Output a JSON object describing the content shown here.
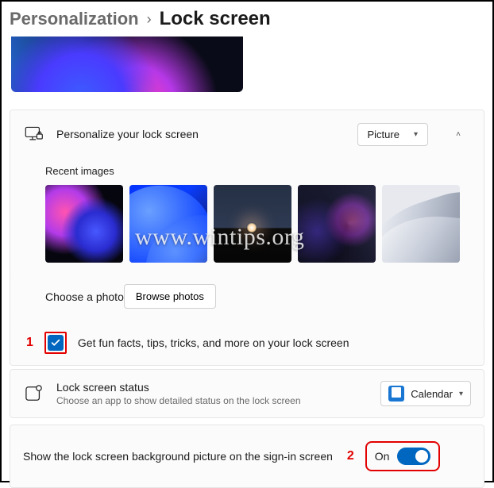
{
  "breadcrumb": {
    "parent": "Personalization",
    "current": "Lock screen"
  },
  "personalize": {
    "title": "Personalize your lock screen",
    "dropdown_value": "Picture"
  },
  "recent_images": {
    "label": "Recent images"
  },
  "choose_photo": {
    "label": "Choose a photo",
    "button": "Browse photos"
  },
  "fun_facts": {
    "annotation": "1",
    "label": "Get fun facts, tips, tricks, and more on your lock screen",
    "checked": true
  },
  "status": {
    "title": "Lock screen status",
    "sub": "Choose an app to show detailed status on the lock screen",
    "app": "Calendar"
  },
  "signin": {
    "annotation": "2",
    "label": "Show the lock screen background picture on the sign-in screen",
    "toggle_label": "On",
    "toggle_on": true
  },
  "icons": {
    "monitor_lock": "monitor-lock-icon",
    "chevron_down": "chevron-down-icon",
    "chevron_up": "chevron-up-icon",
    "badge": "badge-icon",
    "calendar": "calendar-icon"
  },
  "watermark": "www.wintips.org"
}
